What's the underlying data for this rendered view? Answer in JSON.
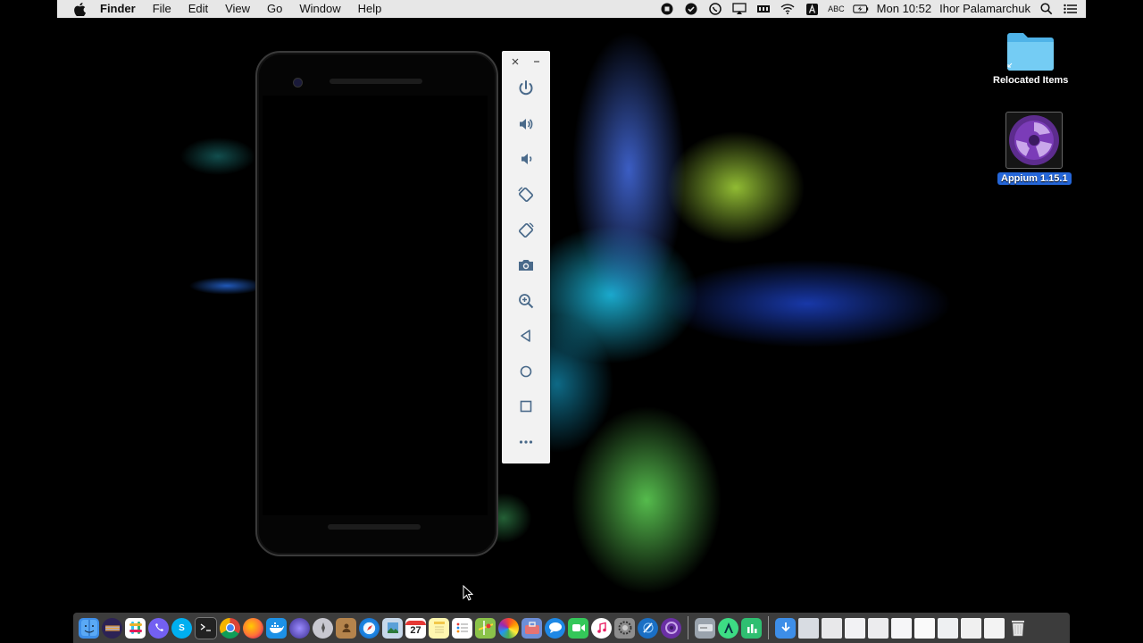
{
  "menubar": {
    "app_name": "Finder",
    "menus": [
      "File",
      "Edit",
      "View",
      "Go",
      "Window",
      "Help"
    ],
    "input_source": "ABC",
    "clock": "Mon 10:52",
    "user": "Ihor Palamarchuk"
  },
  "desktop": {
    "folder_label": "Relocated Items",
    "app_label": "Appium 1.15.1"
  },
  "emulator_toolbar": {
    "tools": [
      "power",
      "volume-up",
      "volume-down",
      "rotate-left",
      "rotate-right",
      "screenshot",
      "zoom",
      "back",
      "home",
      "overview",
      "more"
    ]
  },
  "dock": {
    "apps": [
      "Finder",
      "Eclipse",
      "Slack",
      "Viber",
      "Skype",
      "Terminal",
      "Chrome",
      "Firefox",
      "Docker",
      "Launchpad",
      "Rocket",
      "Contacts",
      "Safari",
      "Preview",
      "Calendar",
      "Notes",
      "Reminders",
      "Maps",
      "Photos",
      "Toolbox",
      "Messages",
      "FaceTime",
      "iTunes",
      "System Preferences",
      "Xcode",
      "Appium",
      "Disk Utility",
      "Android Studio",
      "Numbers",
      "Downloads",
      "Window 1",
      "Window 2",
      "Window 3",
      "Window 4",
      "Window 5",
      "Window 6",
      "Window 7",
      "Window 8",
      "Window 9",
      "Trash"
    ],
    "calendar_day": "27"
  }
}
